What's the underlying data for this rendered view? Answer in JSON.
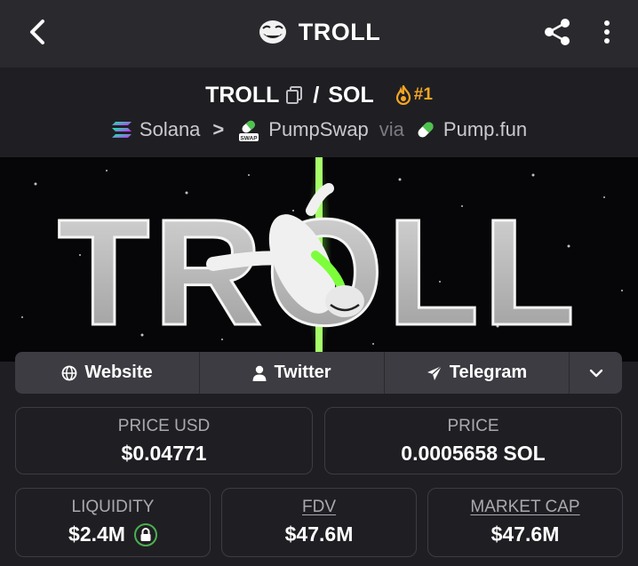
{
  "header": {
    "title": "TROLL"
  },
  "pair": {
    "base": "TROLL",
    "slash": "/",
    "quote": "SOL",
    "rank": "#1"
  },
  "chain": {
    "network": "Solana",
    "separator": ">",
    "dex": "PumpSwap",
    "dex_badge": "SWAP",
    "via": "via",
    "launchpad": "Pump.fun"
  },
  "banner": {
    "text": "TROLL"
  },
  "links": {
    "website": "Website",
    "twitter": "Twitter",
    "telegram": "Telegram"
  },
  "stats": {
    "price_usd_label": "PRICE USD",
    "price_usd_value": "$0.04771",
    "price_label": "PRICE",
    "price_value": "0.0005658 SOL",
    "liquidity_label": "LIQUIDITY",
    "liquidity_value": "$2.4M",
    "fdv_label": "FDV",
    "fdv_value": "$47.6M",
    "mcap_label": "MARKET CAP",
    "mcap_value": "$47.6M"
  },
  "colors": {
    "accent_rank": "#f5a623",
    "lock_green": "#4caf50",
    "banner_glow": "#7cff3a"
  }
}
